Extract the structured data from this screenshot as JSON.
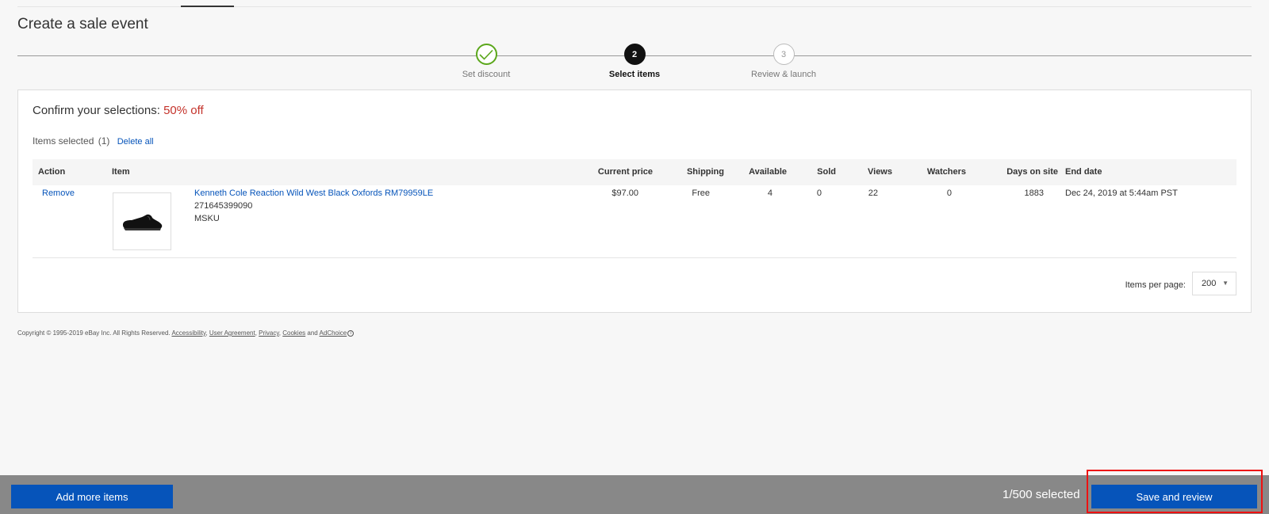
{
  "page": {
    "title": "Create a sale event"
  },
  "stepper": {
    "steps": [
      {
        "number": "",
        "label": "Set discount",
        "state": "complete"
      },
      {
        "number": "2",
        "label": "Select items",
        "state": "current"
      },
      {
        "number": "3",
        "label": "Review & launch",
        "state": "upcoming"
      }
    ]
  },
  "card": {
    "heading_prefix": "Confirm your selections:",
    "discount": "50% off",
    "items_selected_label": "Items selected",
    "items_selected_count": "(1)",
    "delete_all": "Delete all"
  },
  "table": {
    "headers": {
      "action": "Action",
      "item": "Item",
      "current_price": "Current price",
      "shipping": "Shipping",
      "available": "Available",
      "sold": "Sold",
      "views": "Views",
      "watchers": "Watchers",
      "days_on_site": "Days on site",
      "end_date": "End date"
    },
    "rows": [
      {
        "action": "Remove",
        "title": "Kenneth Cole Reaction Wild West Black Oxfords RM79959LE",
        "item_id": "271645399090",
        "sku": "MSKU",
        "current_price": "$97.00",
        "shipping": "Free",
        "available": "4",
        "sold": "0",
        "views": "22",
        "watchers": "0",
        "days_on_site": "1883",
        "end_date": "Dec 24, 2019 at 5:44am PST"
      }
    ]
  },
  "pagination": {
    "items_per_page_label": "Items per page:",
    "items_per_page_value": "200"
  },
  "footer": {
    "copyright": "Copyright © 1995-2019 eBay Inc. All Rights Reserved.",
    "links": [
      "Accessibility",
      "User Agreement",
      "Privacy",
      "Cookies",
      "AdChoice"
    ],
    "and": "and"
  },
  "bottom_bar": {
    "add_more": "Add more items",
    "selected_count": "1/500 selected",
    "save_review": "Save and review"
  },
  "colors": {
    "accent": "#0654ba",
    "discount": "#c4322a",
    "check": "#5ba71b",
    "highlight": "#ee1111"
  }
}
